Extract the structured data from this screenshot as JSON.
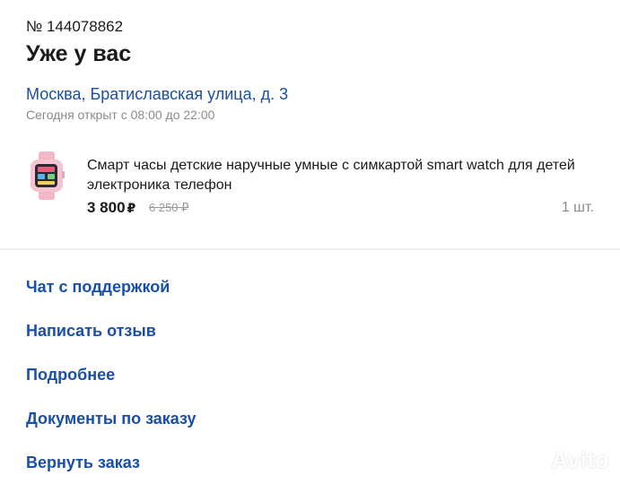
{
  "order": {
    "number": "№ 144078862",
    "status": "Уже у вас",
    "pickup_address": "Москва, Братиславская улица, д. 3",
    "pickup_hours": "Сегодня открыт с 08:00 до 22:00"
  },
  "item": {
    "title": "Смарт часы детские наручные умные с симкартой smart watch для детей электроника телефон",
    "price": "3 800",
    "currency": "₽",
    "old_price": "6 250 ₽",
    "quantity": "1 шт.",
    "thumb_icon": "kids-smartwatch-pink",
    "thumb_color": "#f2b8c6"
  },
  "actions": [
    {
      "label": "Чат с поддержкой"
    },
    {
      "label": "Написать отзыв"
    },
    {
      "label": "Подробнее"
    },
    {
      "label": "Документы по заказу"
    },
    {
      "label": "Вернуть заказ"
    }
  ],
  "watermark": "Avito",
  "colors": {
    "link": "#1a4fa8",
    "muted": "#8a8a8a",
    "text": "#1a1a1a"
  }
}
